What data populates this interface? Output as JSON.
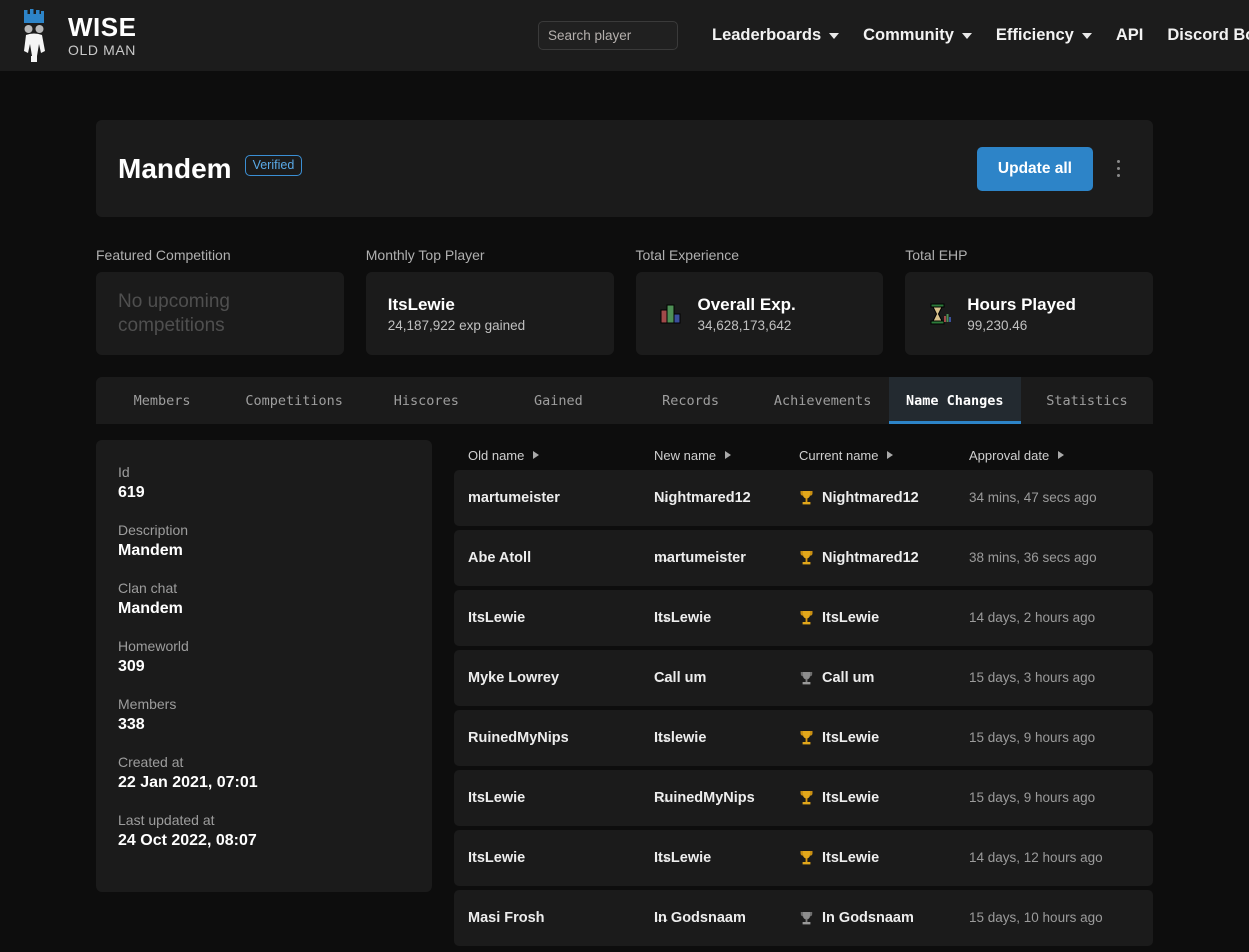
{
  "navbar": {
    "logo_icon": "wise-old-man-logo-icon",
    "brand_title": "WISE",
    "brand_subtitle": "OLD MAN",
    "search": {
      "placeholder": "Search player",
      "value": ""
    },
    "links": [
      {
        "label": "Leaderboards",
        "has_caret": true,
        "icon": "chevron-down-icon"
      },
      {
        "label": "Community",
        "has_caret": true,
        "icon": "chevron-down-icon"
      },
      {
        "label": "Efficiency",
        "has_caret": true,
        "icon": "chevron-down-icon"
      },
      {
        "label": "API",
        "has_caret": false
      },
      {
        "label": "Discord Bot",
        "has_caret": false
      }
    ]
  },
  "hero": {
    "title": "Mandem",
    "badge": "Verified",
    "update_button": "Update all",
    "menu_icon": "kebab-menu-icon"
  },
  "cards": [
    {
      "label": "Featured Competition",
      "empty_text": "No upcoming competitions",
      "empty": true
    },
    {
      "label": "Monthly Top Player",
      "main": "ItsLewie",
      "sub": "24,187,922 exp gained",
      "empty": false
    },
    {
      "label": "Total Experience",
      "icon": "bar-chart-pixel-icon",
      "main": "Overall Exp.",
      "sub": "34,628,173,642",
      "empty": false
    },
    {
      "label": "Total EHP",
      "icon": "hourglass-pixel-icon",
      "main": "Hours Played",
      "sub": "99,230.46",
      "empty": false
    }
  ],
  "tabs": [
    {
      "label": "Members",
      "active": false
    },
    {
      "label": "Competitions",
      "active": false
    },
    {
      "label": "Hiscores",
      "active": false
    },
    {
      "label": "Gained",
      "active": false
    },
    {
      "label": "Records",
      "active": false
    },
    {
      "label": "Achievements",
      "active": false
    },
    {
      "label": "Name Changes",
      "active": true
    },
    {
      "label": "Statistics",
      "active": false
    }
  ],
  "info_panel": [
    {
      "key": "Id",
      "value": "619"
    },
    {
      "key": "Description",
      "value": "Mandem"
    },
    {
      "key": "Clan chat",
      "value": "Mandem"
    },
    {
      "key": "Homeworld",
      "value": "309"
    },
    {
      "key": "Members",
      "value": "338"
    },
    {
      "key": "Created at",
      "value": "22 Jan 2021, 07:01"
    },
    {
      "key": "Last updated at",
      "value": "24 Oct 2022, 08:07"
    }
  ],
  "table": {
    "columns": [
      {
        "label": "Old name",
        "sort_icon": "sort-arrow-icon"
      },
      {
        "label": "New name",
        "sort_icon": "sort-arrow-icon"
      },
      {
        "label": "Current name",
        "sort_icon": "sort-arrow-icon"
      },
      {
        "label": "Approval date",
        "sort_icon": "sort-arrow-icon"
      }
    ],
    "arrow_glyph": "→",
    "rows": [
      {
        "old_name": "martumeister",
        "new_name": "Nightmared12",
        "current_name": "Nightmared12",
        "type_icon": "gold-trophy-icon",
        "approval_date": "34 mins, 47 secs ago"
      },
      {
        "old_name": "Abe Atoll",
        "new_name": "martumeister",
        "current_name": "Nightmared12",
        "type_icon": "gold-trophy-icon",
        "approval_date": "38 mins, 36 secs ago"
      },
      {
        "old_name": "ItsLewie",
        "new_name": "ItsLewie",
        "current_name": "ItsLewie",
        "type_icon": "gold-trophy-icon",
        "approval_date": "14 days, 2 hours ago"
      },
      {
        "old_name": "Myke Lowrey",
        "new_name": "Call um",
        "current_name": "Call um",
        "type_icon": "grey-helmet-icon",
        "approval_date": "15 days, 3 hours ago"
      },
      {
        "old_name": "RuinedMyNips",
        "new_name": "Itslewie",
        "current_name": "ItsLewie",
        "type_icon": "gold-trophy-icon",
        "approval_date": "15 days, 9 hours ago"
      },
      {
        "old_name": "ItsLewie",
        "new_name": "RuinedMyNips",
        "current_name": "ItsLewie",
        "type_icon": "gold-trophy-icon",
        "approval_date": "15 days, 9 hours ago"
      },
      {
        "old_name": "ItsLewie",
        "new_name": "ItsLewie",
        "current_name": "ItsLewie",
        "type_icon": "gold-trophy-icon",
        "approval_date": "14 days, 12 hours ago"
      },
      {
        "old_name": "Masi Frosh",
        "new_name": "In Godsnaam",
        "current_name": "In Godsnaam",
        "type_icon": "grey-helmet-icon",
        "approval_date": "15 days, 10 hours ago"
      }
    ]
  },
  "colors": {
    "page_bg": "#0d0d0d",
    "surface": "#1b1b1b",
    "navbar_bg": "#1c1c1c",
    "accent_blue": "#2d84c8",
    "badge_blue": "#5aa9e6",
    "active_tab_bg": "#232a30",
    "muted_text": "#9d9d9d",
    "gold": "#e8a317"
  }
}
